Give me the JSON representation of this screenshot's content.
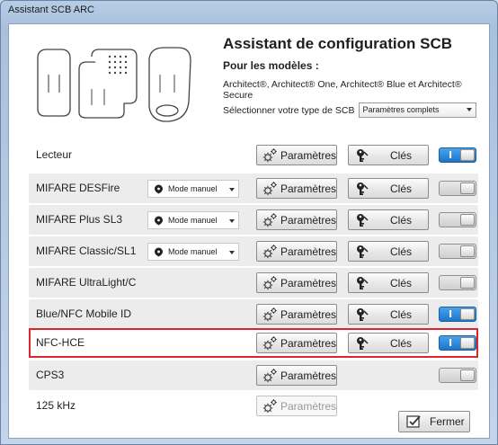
{
  "window": {
    "title": "Assistant SCB ARC"
  },
  "header": {
    "title": "Assistant de configuration SCB",
    "subtitle": "Pour les modèles :",
    "models": "Architect®, Architect® One, Architect® Blue et Architect® Secure",
    "select_label": "Sélectionner votre type de SCB",
    "select_value": "Paramètres complets"
  },
  "labels": {
    "params": "Paramètres",
    "keys": "Clés"
  },
  "rows": [
    {
      "label": "Lecteur",
      "mode": "",
      "toggle": "on"
    },
    {
      "label": "MIFARE DESFire",
      "mode": "Mode manuel",
      "toggle": "off"
    },
    {
      "label": "MIFARE Plus SL3",
      "mode": "Mode manuel",
      "toggle": "off"
    },
    {
      "label": "MIFARE Classic/SL1",
      "mode": "Mode manuel",
      "toggle": "off"
    },
    {
      "label": "MIFARE UltraLight/C",
      "mode": "",
      "toggle": "off"
    },
    {
      "label": "Blue/NFC Mobile ID",
      "mode": "",
      "toggle": "on"
    },
    {
      "label": "NFC-HCE",
      "mode": "",
      "toggle": "on"
    },
    {
      "label": "CPS3",
      "mode": "",
      "toggle": "off"
    },
    {
      "label": "125 kHz",
      "mode": "",
      "toggle": ""
    }
  ],
  "toggle_glyphs": {
    "on": "I",
    "off": "O"
  },
  "footer": {
    "close_label": "Fermer"
  },
  "colors": {
    "highlight": "#d8282d",
    "toggle_on": "#1b74c9"
  }
}
